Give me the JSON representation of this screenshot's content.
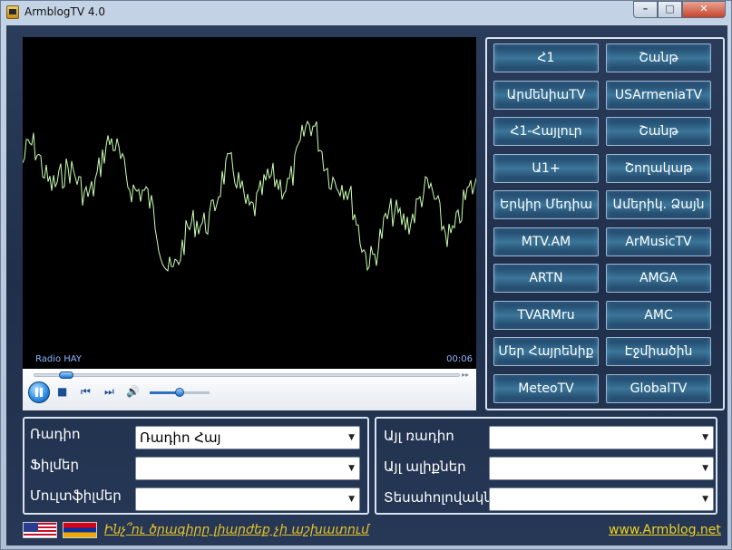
{
  "window": {
    "title": "ArmblogTV 4.0"
  },
  "window_controls": {
    "minimize": "–",
    "maximize": "□",
    "close": "✕"
  },
  "player": {
    "station": "Radio HAY",
    "elapsed": "00:06",
    "seek_back": "◂◂",
    "seek_forward": "▸▸",
    "stop": "■",
    "prev": "⏮",
    "next": "⏭",
    "volume_icon": "🔊",
    "volume_level": 0.5,
    "seek_position": 0.06,
    "viz_color": "#c9ffb0"
  },
  "channels": [
    "Հ1",
    "Շանթ",
    "ԱրմենիաTV",
    "USArmeniaTV",
    "Հ1-Հայլուր",
    "Շանթ",
    "Ա1+",
    "Շողակաթ",
    "Երկիր Մեդիա",
    "Ամերիկ. Ձայն",
    "MTV.AM",
    "ArMusicTV",
    "ARTN",
    "AMGA",
    "TVARMru",
    "AMC",
    "Մեր Հայրենիք",
    "Էջմիածին",
    "MeteoTV",
    "GlobalTV"
  ],
  "left_panel": {
    "radio_label": "Ռադիո",
    "radio_value": "Ռադիո Հայ",
    "films_label": "Ֆիլմեր",
    "films_value": "",
    "cartoons_label": "Մուլտֆիլմեր",
    "cartoons_value": ""
  },
  "right_panel": {
    "other_radio_label": "Այլ ռադիո",
    "other_radio_value": "",
    "other_waves_label": "Այլ ալիքներ",
    "other_waves_value": "",
    "video_clips_label": "Տեսահոլովակներ",
    "video_clips_value": ""
  },
  "footer": {
    "help_link": "Ինչ՞ու ծրագիրը լիարժեք չի աշխատում",
    "site_link": "www.Armblog.net"
  },
  "colors": {
    "accent_link": "#e6c229",
    "panel_bg": "#243654",
    "button_glow": "#3b7699"
  }
}
